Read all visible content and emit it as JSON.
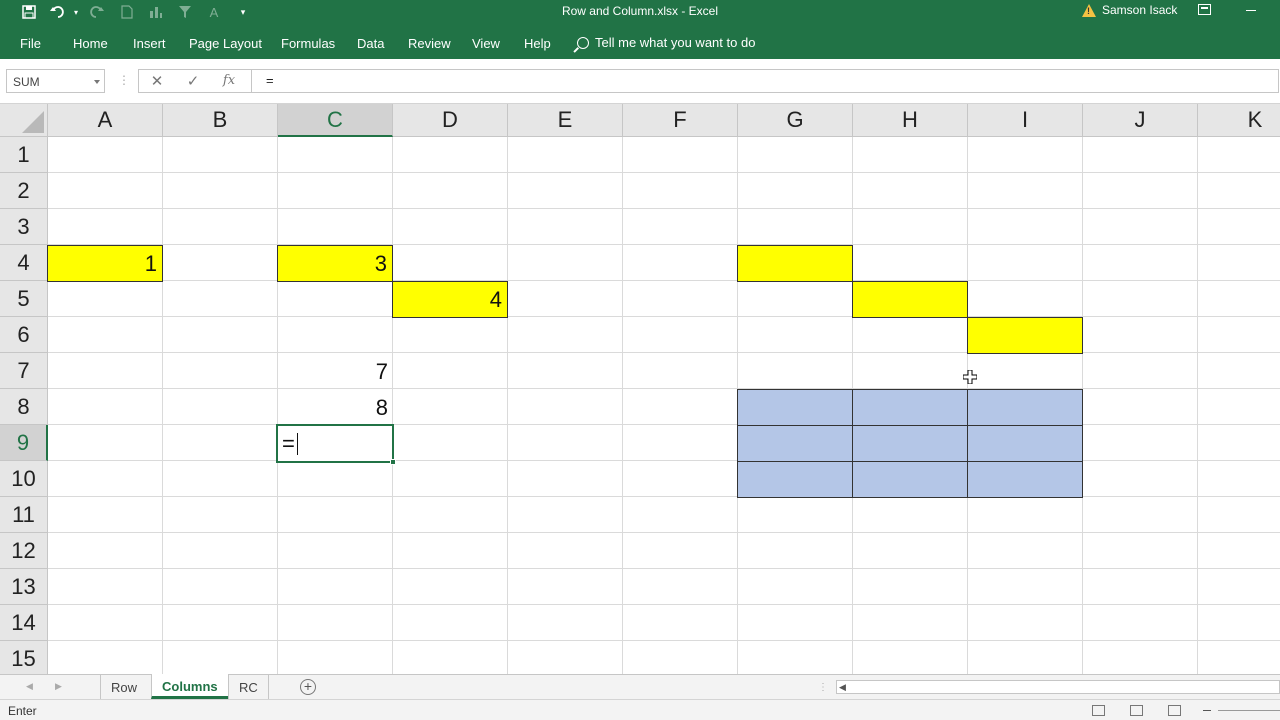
{
  "titlebar": {
    "title": "Row and Column.xlsx  -  Excel",
    "user": "Samson Isack",
    "quick_access": [
      "save-icon",
      "undo-icon",
      "redo-icon",
      "new-file-icon",
      "chart-icon",
      "filter-icon",
      "font-size-icon",
      "customize-icon"
    ]
  },
  "ribbon": {
    "tabs": [
      "File",
      "Home",
      "Insert",
      "Page Layout",
      "Formulas",
      "Data",
      "Review",
      "View",
      "Help"
    ],
    "tell_me": "Tell me what you want to do"
  },
  "formula_bar": {
    "name_box": "SUM",
    "cancel": "✕",
    "enter": "✓",
    "fx": "fx",
    "formula": "="
  },
  "grid": {
    "columns": [
      "A",
      "B",
      "C",
      "D",
      "E",
      "F",
      "G",
      "H",
      "I",
      "J",
      "K"
    ],
    "rows": [
      "1",
      "2",
      "3",
      "4",
      "5",
      "6",
      "7",
      "8",
      "9",
      "10",
      "11",
      "12",
      "13",
      "14",
      "15"
    ],
    "active_column": "C",
    "active_row": "9",
    "cells": {
      "A4": "1",
      "C4": "3",
      "D5": "4",
      "C7": "7",
      "C8": "8",
      "C9": "="
    },
    "highlight_colors": {
      "yellow": "#ffff00",
      "blue": "#b4c6e7",
      "accent": "#217346"
    }
  },
  "sheets": {
    "tabs": [
      "Row",
      "Columns",
      "RC"
    ],
    "active": "Columns"
  },
  "status": {
    "mode": "Enter"
  }
}
